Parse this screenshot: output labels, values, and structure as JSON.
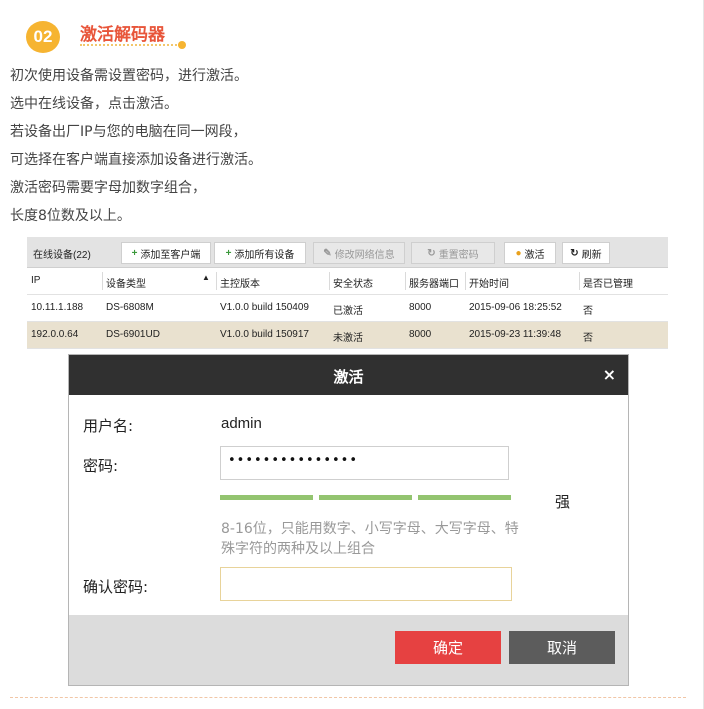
{
  "step": {
    "number": "02",
    "title": "激活解码器"
  },
  "intro_lines": [
    "初次使用设备需设置密码，进行激活。",
    "选中在线设备，点击激活。",
    "若设备出厂IP与您的电脑在同一网段，",
    "可选择在客户端直接添加设备进行激活。",
    "激活密码需要字母加数字组合，",
    "长度8位数及以上。"
  ],
  "device_list": {
    "count_label": "在线设备(22)",
    "toolbar": {
      "add_to_client": "添加至客户端",
      "add_all": "添加所有设备",
      "modify_network": "修改网络信息",
      "reset_password": "重置密码",
      "activate": "激活",
      "refresh": "刷新"
    },
    "columns": [
      "IP",
      "设备类型",
      "主控版本",
      "安全状态",
      "服务器端口",
      "开始时间",
      "是否已管理"
    ],
    "rows": [
      {
        "ip": "10.11.1.188",
        "type": "DS-6808M",
        "version": "V1.0.0 build 150409",
        "status": "已激活",
        "port": "8000",
        "start": "2015-09-06 18:25:52",
        "managed": "否"
      },
      {
        "ip": "192.0.0.64",
        "type": "DS-6901UD",
        "version": "V1.0.0 build 150917",
        "status": "未激活",
        "port": "8000",
        "start": "2015-09-23 11:39:48",
        "managed": "否"
      }
    ]
  },
  "dialog": {
    "title": "激活",
    "close": "×",
    "username_label": "用户名:",
    "username_value": "admin",
    "password_label": "密码:",
    "password_value": "•••••••••••••••",
    "strength_label": "强",
    "hint": "8-16位，只能用数字、小写字母、大写字母、特殊字符的两种及以上组合",
    "confirm_label": "确认密码:",
    "confirm_value": "",
    "ok_label": "确定",
    "cancel_label": "取消"
  },
  "colors": {
    "accent_orange": "#f6b431",
    "title_red": "#e8553a",
    "strength_green": "#93c470",
    "ok_red": "#e64141",
    "dialog_header": "#303030"
  }
}
